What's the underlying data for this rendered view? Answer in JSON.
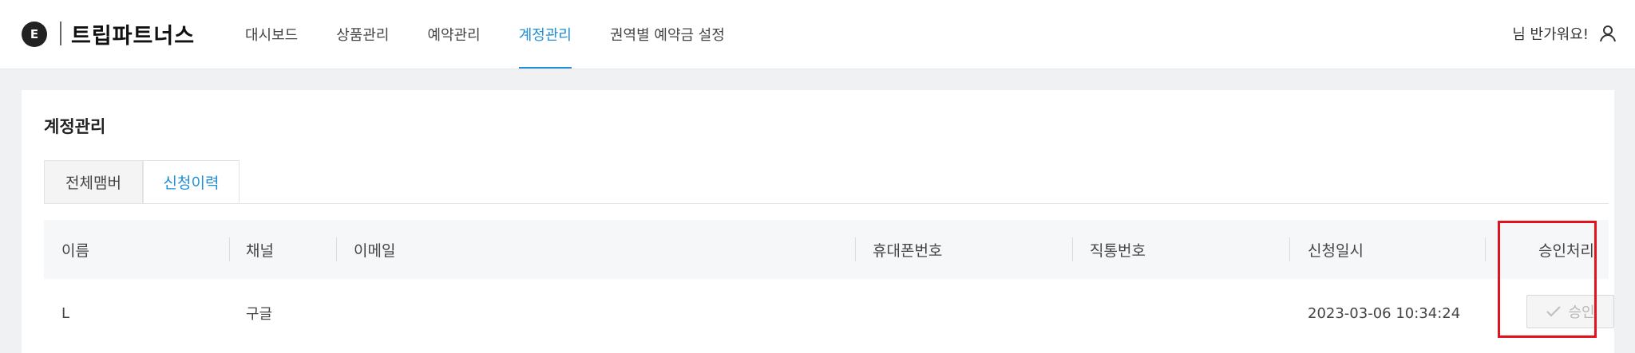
{
  "header": {
    "logo_letter": "E",
    "brand": "트립파트너스",
    "nav": [
      {
        "label": "대시보드"
      },
      {
        "label": "상품관리"
      },
      {
        "label": "예약관리"
      },
      {
        "label": "계정관리",
        "active": true
      },
      {
        "label": "권역별 예약금 설정"
      }
    ],
    "greeting": "님 반가워요!",
    "accent_color": "#1f8fd6"
  },
  "page": {
    "title": "계정관리",
    "tabs": [
      {
        "label": "전체맴버"
      },
      {
        "label": "신청이력",
        "active": true
      }
    ]
  },
  "table": {
    "columns": [
      "이름",
      "채널",
      "이메일",
      "휴대폰번호",
      "직통번호",
      "신청일시",
      "승인처리"
    ],
    "rows": [
      {
        "name": "L",
        "channel": "구글",
        "email": "",
        "mobile": "",
        "direct": "",
        "applied_at": "2023-03-06 10:34:24",
        "action_label": "승인"
      }
    ]
  },
  "highlight_color": "#e1141d"
}
